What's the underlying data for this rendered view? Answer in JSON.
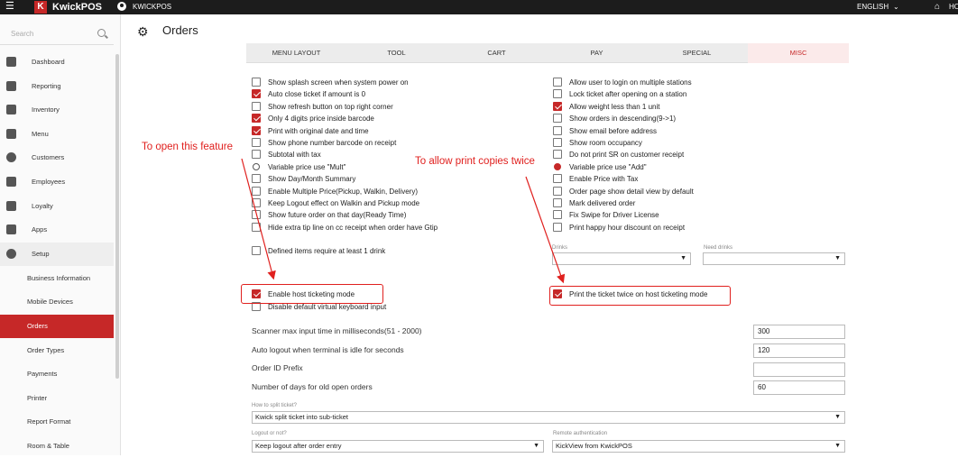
{
  "topbar": {
    "brand": "KwickPOS",
    "store": "KWICKPOS",
    "language": "ENGLISH",
    "home": "HO"
  },
  "sidebar": {
    "search_placeholder": "Search",
    "items": [
      {
        "label": "Dashboard",
        "icon": "dashboard-icon"
      },
      {
        "label": "Reporting",
        "icon": "reporting-icon"
      },
      {
        "label": "Inventory",
        "icon": "inventory-icon"
      },
      {
        "label": "Menu",
        "icon": "menu-grid-icon"
      },
      {
        "label": "Customers",
        "icon": "customers-icon"
      },
      {
        "label": "Employees",
        "icon": "employees-icon"
      },
      {
        "label": "Loyalty",
        "icon": "loyalty-tag-icon"
      },
      {
        "label": "Apps",
        "icon": "apps-grid-icon"
      },
      {
        "label": "Setup",
        "icon": "setup-gear-icon"
      }
    ],
    "subitems": [
      "Business Information",
      "Mobile Devices",
      "Orders",
      "Order Types",
      "Payments",
      "Printer",
      "Report Format",
      "Room & Table"
    ],
    "active": "Orders"
  },
  "page": {
    "title": "Orders"
  },
  "tabs": [
    "MENU LAYOUT",
    "TOOL",
    "CART",
    "PAY",
    "SPECIAL",
    "MISC"
  ],
  "active_tab": "MISC",
  "left_options": [
    {
      "label": "Show splash screen when system power on",
      "checked": false,
      "type": "check"
    },
    {
      "label": "Auto close ticket if amount is 0",
      "checked": true,
      "type": "check"
    },
    {
      "label": "Show refresh button on top right corner",
      "checked": false,
      "type": "check"
    },
    {
      "label": "Only 4 digits price inside barcode",
      "checked": true,
      "type": "check"
    },
    {
      "label": "Print with original date and time",
      "checked": true,
      "type": "check"
    },
    {
      "label": "Show phone number barcode on receipt",
      "checked": false,
      "type": "check"
    },
    {
      "label": "Subtotal with tax",
      "checked": false,
      "type": "check"
    },
    {
      "label": "Variable price use \"Mult\"",
      "checked": false,
      "type": "radio"
    },
    {
      "label": "Show Day/Month Summary",
      "checked": false,
      "type": "check"
    },
    {
      "label": "Enable Multiple Price(Pickup, Walkin, Delivery)",
      "checked": false,
      "type": "check"
    },
    {
      "label": "Keep Logout effect on Walkin and Pickup mode",
      "checked": false,
      "type": "check"
    },
    {
      "label": "Show future order on that day(Ready Time)",
      "checked": false,
      "type": "check"
    },
    {
      "label": "Hide extra tip line on cc receipt when order have Gtip",
      "checked": false,
      "type": "check"
    }
  ],
  "right_options": [
    {
      "label": "Allow user to login on multiple stations",
      "checked": false,
      "type": "check"
    },
    {
      "label": "Lock ticket after opening on a station",
      "checked": false,
      "type": "check"
    },
    {
      "label": "Allow weight less than 1 unit",
      "checked": true,
      "type": "check"
    },
    {
      "label": "Show orders in descending(9->1)",
      "checked": false,
      "type": "check"
    },
    {
      "label": "Show email before address",
      "checked": false,
      "type": "check"
    },
    {
      "label": "Show room occupancy",
      "checked": false,
      "type": "check"
    },
    {
      "label": "Do not print SR on customer receipt",
      "checked": false,
      "type": "check"
    },
    {
      "label": "Variable price use \"Add\"",
      "checked": true,
      "type": "radio"
    },
    {
      "label": "Enable Price with Tax",
      "checked": false,
      "type": "check"
    },
    {
      "label": "Order page show detail view by default",
      "checked": false,
      "type": "check"
    },
    {
      "label": "Mark delivered order",
      "checked": false,
      "type": "check"
    },
    {
      "label": "Fix Swipe for Driver License",
      "checked": false,
      "type": "check"
    },
    {
      "label": "Print happy hour discount on receipt",
      "checked": false,
      "type": "check"
    }
  ],
  "defined_items": {
    "label": "Defined items require at least 1 drink",
    "checked": false
  },
  "drinks": {
    "label": "Drinks",
    "value": ""
  },
  "need_drinks": {
    "label": "Need drinks",
    "value": ""
  },
  "host_ticketing": {
    "label": "Enable host ticketing mode",
    "checked": true
  },
  "disable_keyboard": {
    "label": "Disable default virtual keyboard input",
    "checked": false
  },
  "print_twice": {
    "label": "Print the ticket twice on host ticketing mode",
    "checked": true
  },
  "fields": [
    {
      "label": "Scanner max input time in milliseconds(51 - 2000)",
      "value": "300"
    },
    {
      "label": "Auto logout when terminal is idle for seconds",
      "value": "120"
    },
    {
      "label": "Order ID Prefix",
      "value": ""
    },
    {
      "label": "Number of days for old open orders",
      "value": "60"
    }
  ],
  "split_ticket": {
    "label": "How to split ticket?",
    "value": "Kwick split ticket into sub-ticket"
  },
  "logout": {
    "label": "Logout or not?",
    "value": "Keep logout after order entry"
  },
  "remote_auth": {
    "label": "Remote authentication",
    "value": "KickView from KwickPOS"
  },
  "annotations": {
    "left": "To open this feature",
    "right": "To allow print copies twice"
  },
  "colors": {
    "accent": "#c62828",
    "annotation": "#e0201e"
  }
}
